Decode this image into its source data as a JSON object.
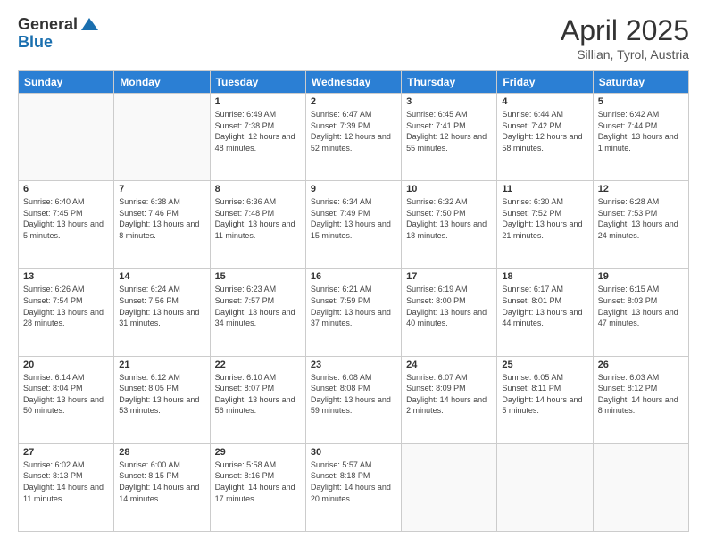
{
  "header": {
    "logo_general": "General",
    "logo_blue": "Blue",
    "month_title": "April 2025",
    "subtitle": "Sillian, Tyrol, Austria"
  },
  "days_of_week": [
    "Sunday",
    "Monday",
    "Tuesday",
    "Wednesday",
    "Thursday",
    "Friday",
    "Saturday"
  ],
  "weeks": [
    [
      {
        "day": "",
        "info": ""
      },
      {
        "day": "",
        "info": ""
      },
      {
        "day": "1",
        "info": "Sunrise: 6:49 AM\nSunset: 7:38 PM\nDaylight: 12 hours and 48 minutes."
      },
      {
        "day": "2",
        "info": "Sunrise: 6:47 AM\nSunset: 7:39 PM\nDaylight: 12 hours and 52 minutes."
      },
      {
        "day": "3",
        "info": "Sunrise: 6:45 AM\nSunset: 7:41 PM\nDaylight: 12 hours and 55 minutes."
      },
      {
        "day": "4",
        "info": "Sunrise: 6:44 AM\nSunset: 7:42 PM\nDaylight: 12 hours and 58 minutes."
      },
      {
        "day": "5",
        "info": "Sunrise: 6:42 AM\nSunset: 7:44 PM\nDaylight: 13 hours and 1 minute."
      }
    ],
    [
      {
        "day": "6",
        "info": "Sunrise: 6:40 AM\nSunset: 7:45 PM\nDaylight: 13 hours and 5 minutes."
      },
      {
        "day": "7",
        "info": "Sunrise: 6:38 AM\nSunset: 7:46 PM\nDaylight: 13 hours and 8 minutes."
      },
      {
        "day": "8",
        "info": "Sunrise: 6:36 AM\nSunset: 7:48 PM\nDaylight: 13 hours and 11 minutes."
      },
      {
        "day": "9",
        "info": "Sunrise: 6:34 AM\nSunset: 7:49 PM\nDaylight: 13 hours and 15 minutes."
      },
      {
        "day": "10",
        "info": "Sunrise: 6:32 AM\nSunset: 7:50 PM\nDaylight: 13 hours and 18 minutes."
      },
      {
        "day": "11",
        "info": "Sunrise: 6:30 AM\nSunset: 7:52 PM\nDaylight: 13 hours and 21 minutes."
      },
      {
        "day": "12",
        "info": "Sunrise: 6:28 AM\nSunset: 7:53 PM\nDaylight: 13 hours and 24 minutes."
      }
    ],
    [
      {
        "day": "13",
        "info": "Sunrise: 6:26 AM\nSunset: 7:54 PM\nDaylight: 13 hours and 28 minutes."
      },
      {
        "day": "14",
        "info": "Sunrise: 6:24 AM\nSunset: 7:56 PM\nDaylight: 13 hours and 31 minutes."
      },
      {
        "day": "15",
        "info": "Sunrise: 6:23 AM\nSunset: 7:57 PM\nDaylight: 13 hours and 34 minutes."
      },
      {
        "day": "16",
        "info": "Sunrise: 6:21 AM\nSunset: 7:59 PM\nDaylight: 13 hours and 37 minutes."
      },
      {
        "day": "17",
        "info": "Sunrise: 6:19 AM\nSunset: 8:00 PM\nDaylight: 13 hours and 40 minutes."
      },
      {
        "day": "18",
        "info": "Sunrise: 6:17 AM\nSunset: 8:01 PM\nDaylight: 13 hours and 44 minutes."
      },
      {
        "day": "19",
        "info": "Sunrise: 6:15 AM\nSunset: 8:03 PM\nDaylight: 13 hours and 47 minutes."
      }
    ],
    [
      {
        "day": "20",
        "info": "Sunrise: 6:14 AM\nSunset: 8:04 PM\nDaylight: 13 hours and 50 minutes."
      },
      {
        "day": "21",
        "info": "Sunrise: 6:12 AM\nSunset: 8:05 PM\nDaylight: 13 hours and 53 minutes."
      },
      {
        "day": "22",
        "info": "Sunrise: 6:10 AM\nSunset: 8:07 PM\nDaylight: 13 hours and 56 minutes."
      },
      {
        "day": "23",
        "info": "Sunrise: 6:08 AM\nSunset: 8:08 PM\nDaylight: 13 hours and 59 minutes."
      },
      {
        "day": "24",
        "info": "Sunrise: 6:07 AM\nSunset: 8:09 PM\nDaylight: 14 hours and 2 minutes."
      },
      {
        "day": "25",
        "info": "Sunrise: 6:05 AM\nSunset: 8:11 PM\nDaylight: 14 hours and 5 minutes."
      },
      {
        "day": "26",
        "info": "Sunrise: 6:03 AM\nSunset: 8:12 PM\nDaylight: 14 hours and 8 minutes."
      }
    ],
    [
      {
        "day": "27",
        "info": "Sunrise: 6:02 AM\nSunset: 8:13 PM\nDaylight: 14 hours and 11 minutes."
      },
      {
        "day": "28",
        "info": "Sunrise: 6:00 AM\nSunset: 8:15 PM\nDaylight: 14 hours and 14 minutes."
      },
      {
        "day": "29",
        "info": "Sunrise: 5:58 AM\nSunset: 8:16 PM\nDaylight: 14 hours and 17 minutes."
      },
      {
        "day": "30",
        "info": "Sunrise: 5:57 AM\nSunset: 8:18 PM\nDaylight: 14 hours and 20 minutes."
      },
      {
        "day": "",
        "info": ""
      },
      {
        "day": "",
        "info": ""
      },
      {
        "day": "",
        "info": ""
      }
    ]
  ]
}
